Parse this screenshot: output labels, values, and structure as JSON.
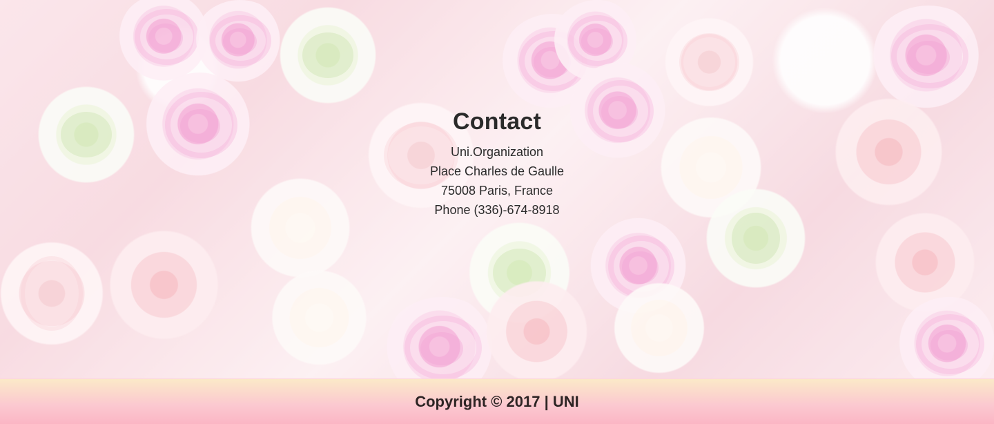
{
  "contact": {
    "title": "Contact",
    "lines": [
      "Uni.Organization",
      "Place Charles de Gaulle",
      "75008 Paris, France",
      "Phone (336)-674-8918"
    ]
  },
  "footer": {
    "copyright_prefix": "Copyright © 2017 | ",
    "brand": "UNI"
  },
  "colors": {
    "text": "#2b2b2b",
    "footer_top": "#fbe9c8",
    "footer_bottom": "#fbb5c4",
    "rose_pink": "#f18ac8"
  }
}
